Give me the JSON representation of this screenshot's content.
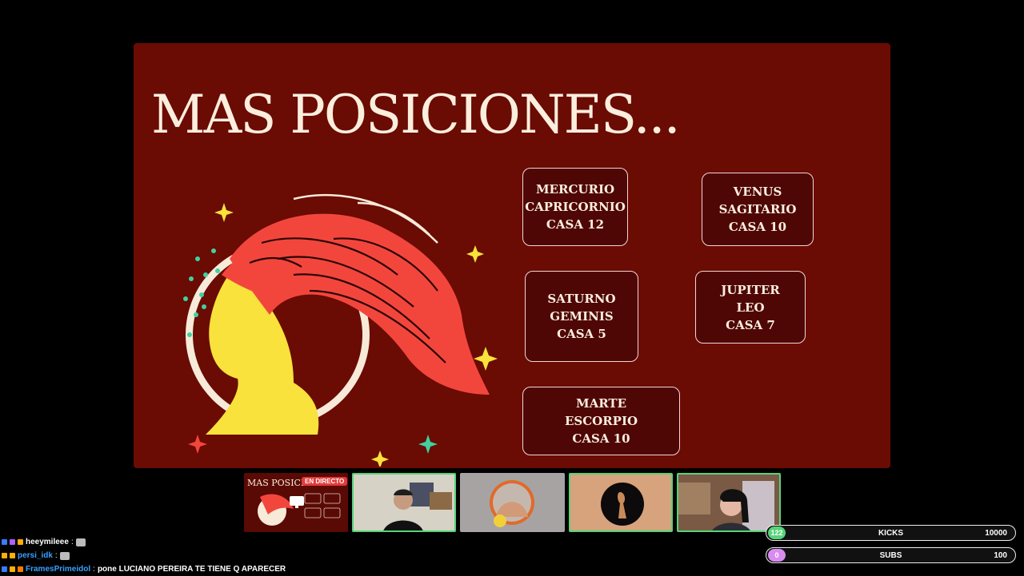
{
  "slide": {
    "title": "MAS POSICIONES...",
    "positions": [
      {
        "planet": "MERCURIO",
        "sign": "CAPRICORNIO",
        "house": "CASA 12"
      },
      {
        "planet": "VENUS",
        "sign": "SAGITARIO",
        "house": "CASA 10"
      },
      {
        "planet": "SATURNO",
        "sign": "GEMINIS",
        "house": "CASA 5"
      },
      {
        "planet": "JUPITER",
        "sign": "LEO",
        "house": "CASA 7"
      },
      {
        "planet": "MARTE",
        "sign": "ESCORPIO",
        "house": "CASA 10"
      }
    ]
  },
  "participants": {
    "live_badge": "EN DIRECTO",
    "screen_share_title": "MAS POSICIONES..."
  },
  "chat": [
    {
      "user": "heeymileee",
      "message": "",
      "color": "#ffffff"
    },
    {
      "user": "persi_idk",
      "message": "",
      "color": "#3aa0ff"
    },
    {
      "user": "FramesPrimeidol",
      "message": "pone LUCIANO PEREIRA TE TIENE Q APARECER",
      "color": "#3aa0ff"
    }
  ],
  "goals": {
    "kicks": {
      "label": "KICKS",
      "current": "122",
      "goal": "10000",
      "progress": 0.0122,
      "color": "#57d37a"
    },
    "subs": {
      "label": "SUBS",
      "current": "0",
      "goal": "100",
      "progress": 0,
      "color": "#d98cf0"
    }
  },
  "colors": {
    "slide_bg": "#6a0b04",
    "box_bg": "#4f0706",
    "text": "#fbeedd",
    "accent_green": "#57d37a"
  }
}
